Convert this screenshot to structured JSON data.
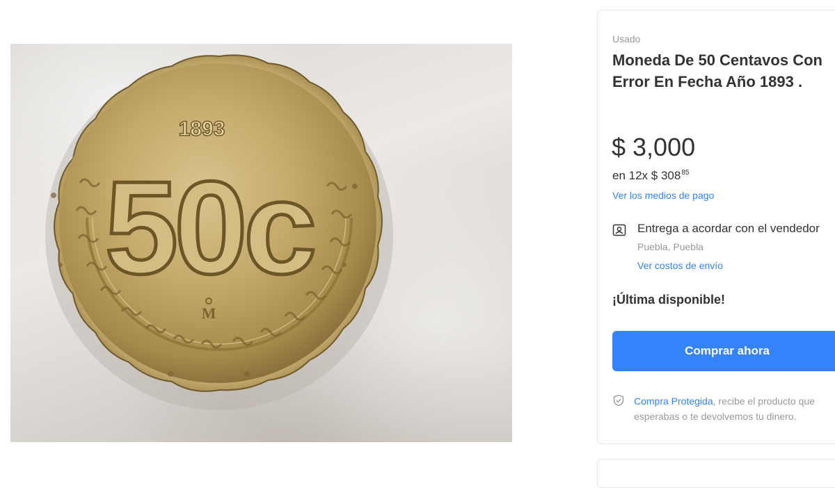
{
  "gallery": {
    "main_image_icon": "coin-photo",
    "coin_year": "1893",
    "coin_denomination": "50c"
  },
  "product": {
    "condition": "Usado",
    "title": "Moneda De 50 Centavos Con Error En Fecha Año 1893 .",
    "price": {
      "currency": "$",
      "amount": "3,000"
    },
    "installments": {
      "text": "en 12x $ 308",
      "cents": "85"
    },
    "payment_link": "Ver los medios de pago",
    "shipping": {
      "icon": "user-card-icon",
      "title": "Entrega a acordar con el vendedor",
      "location": "Puebla, Puebla",
      "link": "Ver costos de envío"
    },
    "stock": "¡Última disponible!",
    "buy_label": "Comprar ahora",
    "protection": {
      "icon": "shield-check-icon",
      "link": "Compra Protegida",
      "text": ", recibe el producto que esperabas o te devolvemos tu dinero."
    }
  },
  "colors": {
    "accent": "#3483fa",
    "text": "#333333",
    "muted": "#999999",
    "coin_gold": "#b89a55"
  }
}
